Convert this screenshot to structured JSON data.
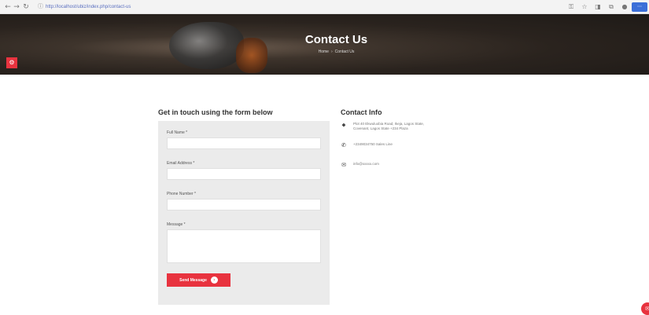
{
  "browser": {
    "url": "http://localhost/ubiz/index.php/contact-us",
    "icons": [
      "back-icon",
      "forward-icon",
      "reload-icon",
      "home-icon"
    ]
  },
  "hero": {
    "title": "Contact Us",
    "breadcrumb": [
      "Home",
      "Contact Us"
    ]
  },
  "form": {
    "heading": "Get in touch using the form below",
    "fields": [
      {
        "label": "Full Name *"
      },
      {
        "label": "Email Address *"
      },
      {
        "label": "Phone Number *"
      }
    ],
    "message_label": "Message *",
    "submit_label": "Send Message"
  },
  "contact": {
    "heading": "Contact Info",
    "address": "Plot 40 Ekwuluobia Road, Ikeja, Lagos State,\nCovenant, Lagos State +234 Plaza",
    "phone": "+2349034750 Sales Line",
    "email": "info@xxxxx.com"
  },
  "colors": {
    "accent": "#e8333f",
    "panel": "#ebebeb"
  }
}
